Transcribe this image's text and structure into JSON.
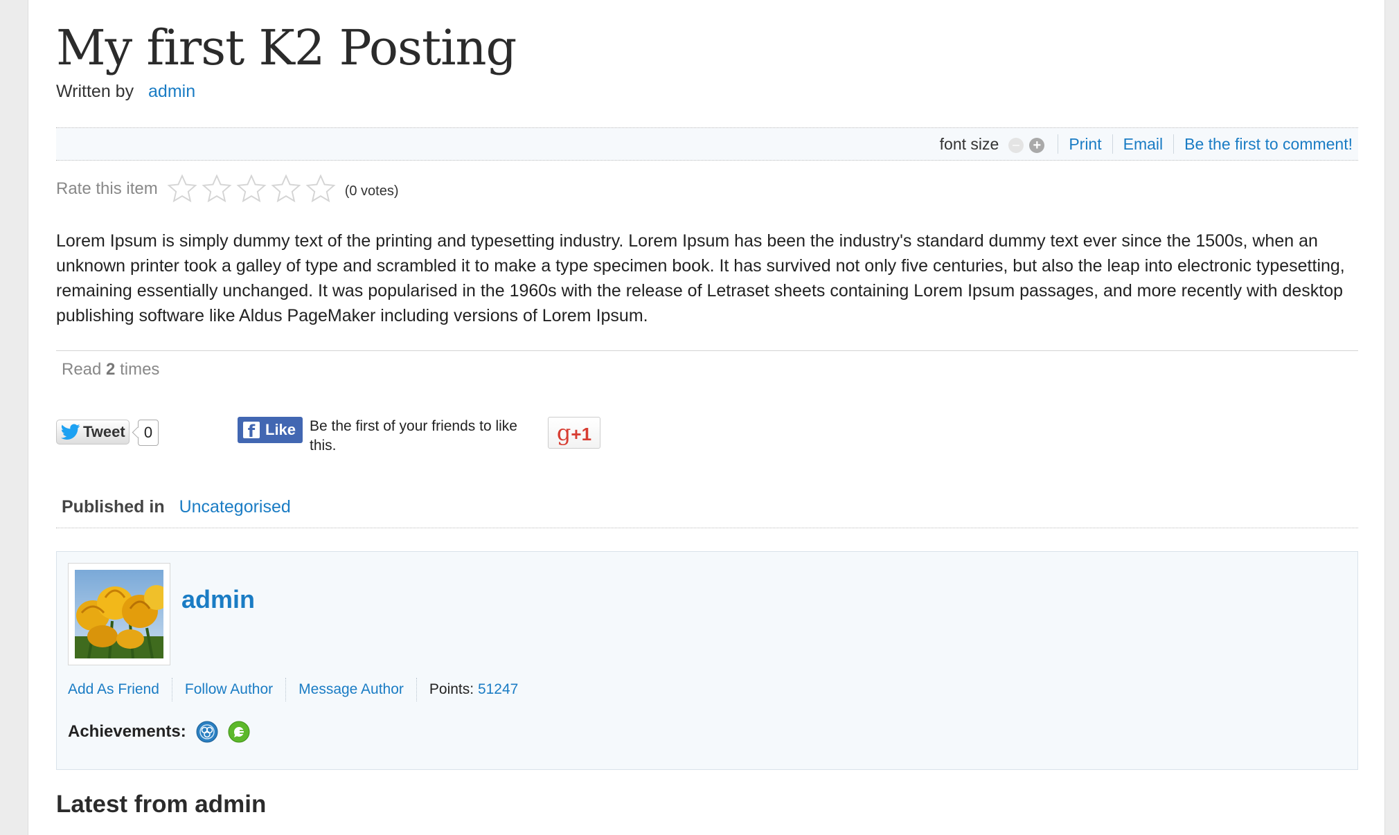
{
  "article": {
    "title": "My first K2 Posting",
    "written_by_label": "Written by",
    "author": "admin",
    "body": "Lorem Ipsum is simply dummy text of the printing and typesetting industry. Lorem Ipsum has been the industry's standard dummy text ever since the 1500s, when an unknown printer took a galley of type and scrambled it to make a type specimen book. It has survived not only five centuries, but also the leap into electronic typesetting, remaining essentially unchanged. It was popularised in the 1960s with the release of Letraset sheets containing Lorem Ipsum passages, and more recently with desktop publishing software like Aldus PageMaker including versions of Lorem Ipsum."
  },
  "toolbar": {
    "font_size_label": "font size",
    "decrease_icon": "minus-circle-icon",
    "increase_icon": "plus-circle-icon",
    "print": "Print",
    "email": "Email",
    "comment": "Be the first to comment!"
  },
  "rating": {
    "label": "Rate this item",
    "stars_total": 5,
    "stars_filled": 0,
    "votes": "(0 votes)"
  },
  "hits": {
    "prefix": "Read",
    "count": "2",
    "suffix": "times"
  },
  "social": {
    "tweet_label": "Tweet",
    "tweet_count": "0",
    "fb_like_label": "Like",
    "fb_text": "Be the first of your friends to like this.",
    "gplus_g": "g",
    "gplus_plus": "+1"
  },
  "category": {
    "label": "Published in",
    "name": "Uncategorised"
  },
  "author_box": {
    "name": "admin",
    "links": {
      "add_friend": "Add As Friend",
      "follow": "Follow Author",
      "message": "Message Author"
    },
    "points_label": "Points:",
    "points_value": "51247",
    "achievements_label": "Achievements:",
    "badges": [
      "network-badge-icon",
      "chat-badge-icon"
    ]
  },
  "latest": {
    "heading": "Latest from admin"
  },
  "colors": {
    "link": "#1a7cc4",
    "author_box_bg": "#f5f9fc",
    "toolbar_bg": "#f6f9fc",
    "facebook": "#4267b2",
    "google_plus": "#d73d32"
  }
}
